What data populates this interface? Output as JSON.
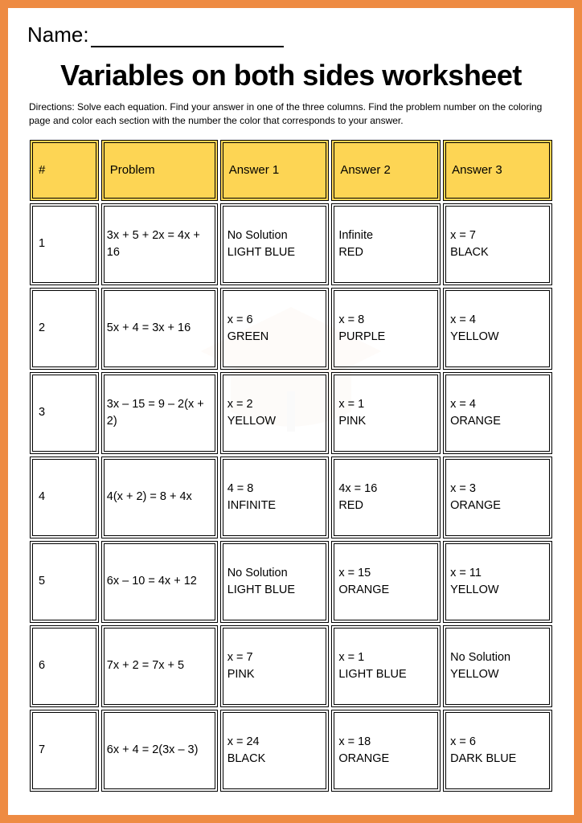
{
  "name_label": "Name:",
  "title": "Variables on both sides worksheet",
  "directions": "Directions: Solve each equation. Find your answer in one of the three columns. Find the problem number on the coloring page and color each section with the number the color that corresponds to your answer.",
  "headers": {
    "num": "#",
    "problem": "Problem",
    "ans1": "Answer 1",
    "ans2": "Answer 2",
    "ans3": "Answer 3"
  },
  "rows": [
    {
      "num": "1",
      "problem": " 3x + 5 + 2x = 4x + 16",
      "a1": "No Solution",
      "c1": "LIGHT BLUE",
      "a2": "Infinite",
      "c2": "RED",
      "a3": "x = 7",
      "c3": "BLACK"
    },
    {
      "num": "2",
      "problem": " 5x + 4 = 3x + 16",
      "a1": "x = 6",
      "c1": "GREEN",
      "a2": "x = 8",
      "c2": "PURPLE",
      "a3": "x = 4",
      "c3": "YELLOW"
    },
    {
      "num": "3",
      "problem": " 3x – 15 = 9 – 2(x + 2)",
      "a1": "x = 2",
      "c1": "YELLOW",
      "a2": "x = 1",
      "c2": "PINK",
      "a3": "x = 4",
      "c3": "ORANGE"
    },
    {
      "num": "4",
      "problem": " 4(x + 2) = 8 + 4x",
      "a1": "4 = 8",
      "c1": "INFINITE",
      "a2": "4x = 16",
      "c2": "RED",
      "a3": "x = 3",
      "c3": "ORANGE"
    },
    {
      "num": "5",
      "problem": " 6x – 10 = 4x + 12",
      "a1": "No Solution",
      "c1": "LIGHT BLUE",
      "a2": "x = 15",
      "c2": "ORANGE",
      "a3": "x = 11",
      "c3": "YELLOW"
    },
    {
      "num": "6",
      "problem": " 7x + 2 = 7x + 5",
      "a1": "x = 7",
      "c1": "PINK",
      "a2": "x = 1",
      "c2": "LIGHT BLUE",
      "a3": "No Solution",
      "c3": "YELLOW"
    },
    {
      "num": "7",
      "problem": " 6x + 4 = 2(3x – 3)",
      "a1": "x = 24",
      "c1": "BLACK",
      "a2": "x = 18",
      "c2": "ORANGE",
      "a3": "x = 6",
      "c3": "DARK BLUE"
    }
  ]
}
